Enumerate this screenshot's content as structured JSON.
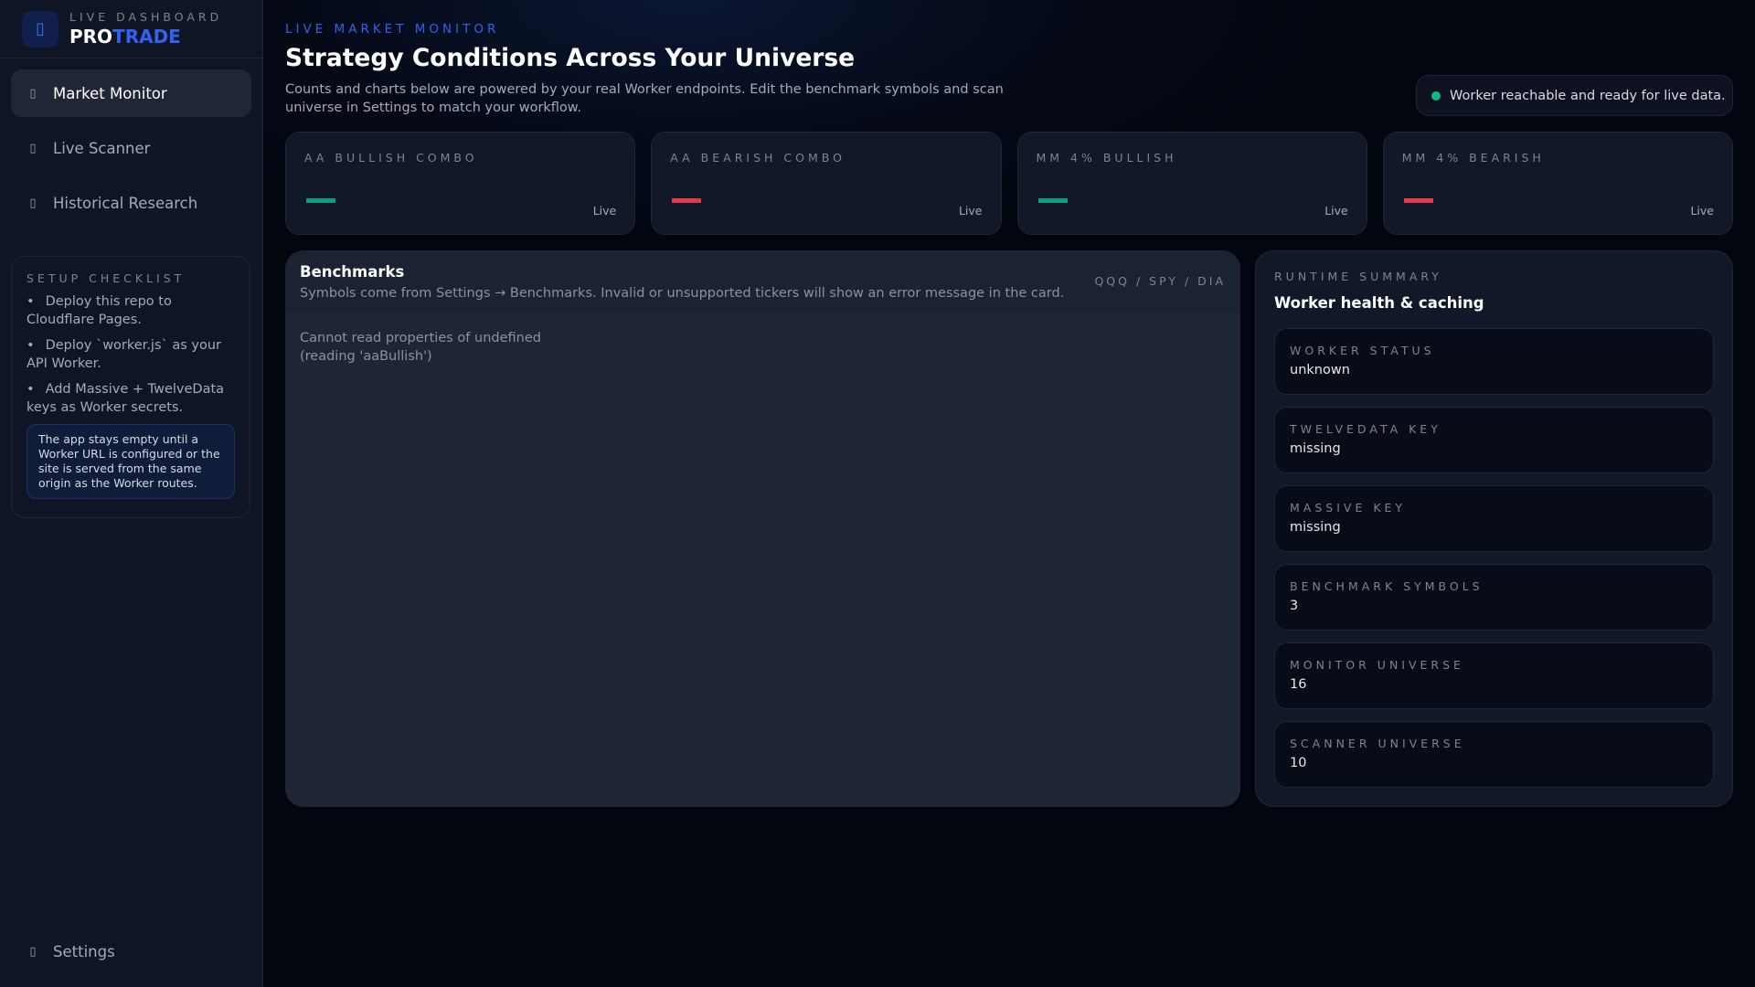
{
  "brand": {
    "eyebrow": "LIVE DASHBOARD",
    "name_part1": "PRO",
    "name_part2": "TRADE",
    "icon": "chart-icon"
  },
  "nav": [
    {
      "label": "Market Monitor",
      "icon": "monitor-icon",
      "active": true
    },
    {
      "label": "Live Scanner",
      "icon": "scanner-icon"
    },
    {
      "label": "Historical Research",
      "icon": "history-icon"
    }
  ],
  "checklist": {
    "title": "SETUP CHECKLIST",
    "items": [
      "Deploy this repo to Cloudflare Pages.",
      "Deploy `worker.js` as your API Worker.",
      "Add Massive + TwelveData keys as Worker secrets."
    ],
    "note": "The app stays empty until a Worker URL is configured or the site is served from the same origin as the Worker routes."
  },
  "settings": {
    "label": "Settings",
    "icon": "gear-icon"
  },
  "header": {
    "eyebrow": "LIVE MARKET MONITOR",
    "title": "Strategy Conditions Across Your Universe",
    "description": "Counts and charts below are powered by your real Worker endpoints. Edit the benchmark symbols and scan universe in Settings to match your workflow.",
    "status": "Worker reachable and ready for live data."
  },
  "cards": [
    {
      "label": "AA BULLISH COMBO",
      "status": "Live",
      "color": "#0f9d83"
    },
    {
      "label": "AA BEARISH COMBO",
      "status": "Live",
      "color": "#e5384a"
    },
    {
      "label": "MM 4% BULLISH",
      "status": "Live",
      "color": "#0f9d83"
    },
    {
      "label": "MM 4% BEARISH",
      "status": "Live",
      "color": "#e5384a"
    }
  ],
  "benchmarks": {
    "title": "Benchmarks",
    "subtitle": "Symbols come from Settings → Benchmarks. Invalid or unsupported tickers will show an error message in the card.",
    "symbols": "QQQ / SPY / DIA",
    "error": "Cannot read properties of undefined (reading 'aaBullish')"
  },
  "runtime": {
    "eyebrow": "RUNTIME SUMMARY",
    "title": "Worker health & caching",
    "stats": [
      {
        "label": "WORKER STATUS",
        "value": "unknown"
      },
      {
        "label": "TWELVEDATA KEY",
        "value": "missing"
      },
      {
        "label": "MASSIVE KEY",
        "value": "missing"
      },
      {
        "label": "BENCHMARK SYMBOLS",
        "value": "3"
      },
      {
        "label": "MONITOR UNIVERSE",
        "value": "16"
      },
      {
        "label": "SCANNER UNIVERSE",
        "value": "10"
      }
    ]
  }
}
